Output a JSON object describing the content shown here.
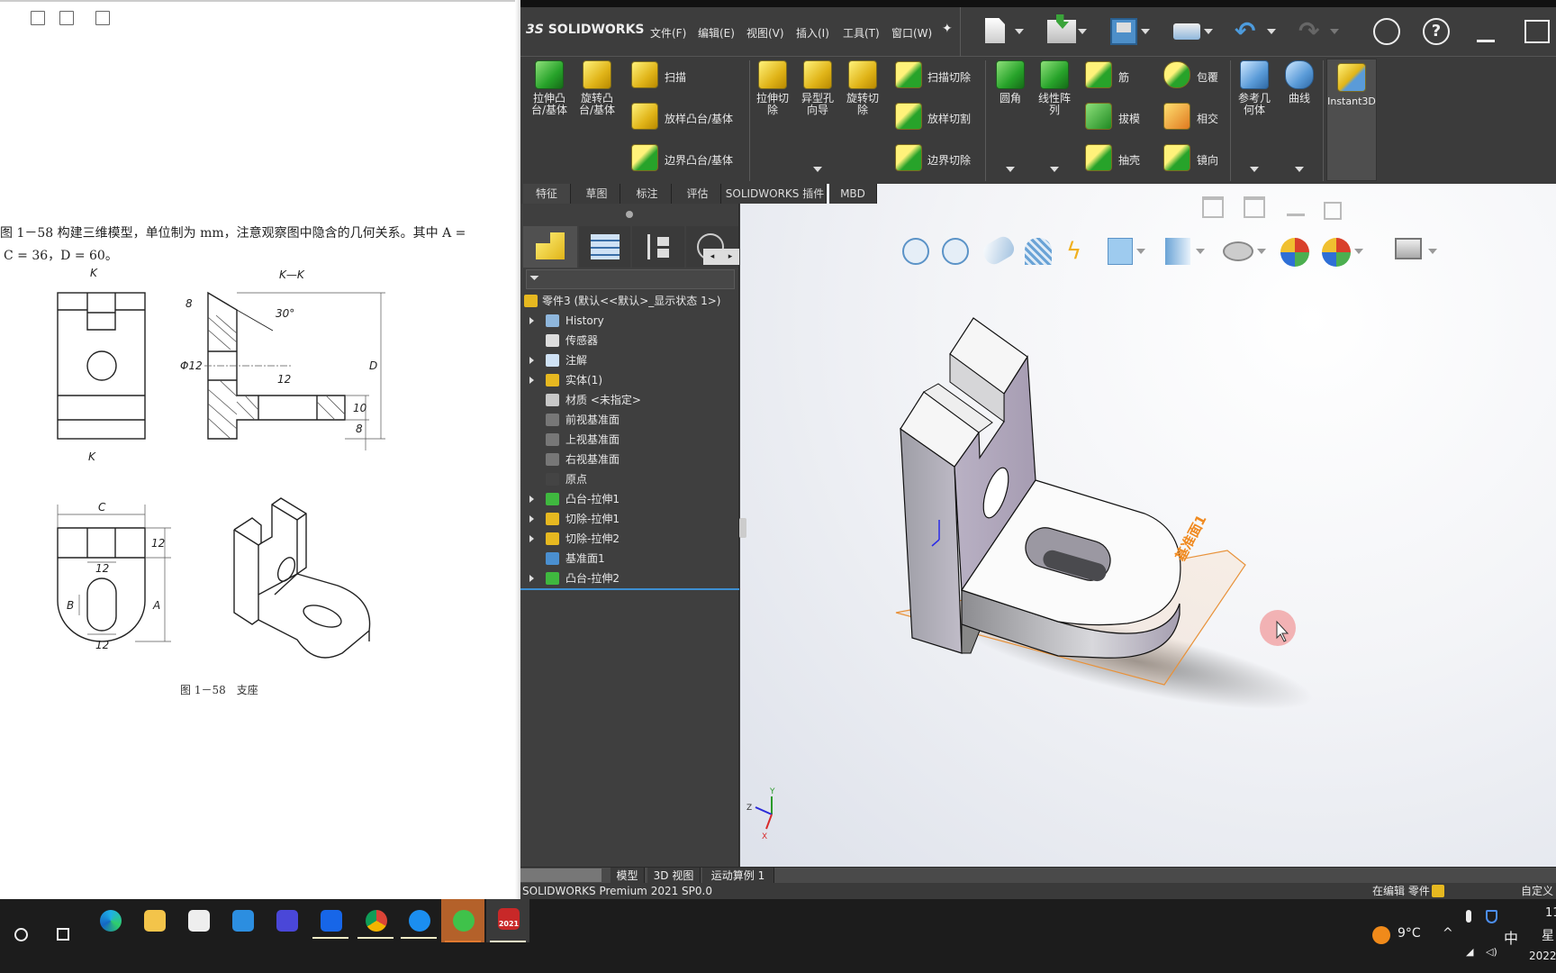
{
  "pdf": {
    "toolbar_icons": [
      "rotate-icon",
      "edit-icon",
      "download-icon"
    ],
    "text_line1": "图 1－58 构建三维模型，单位制为 mm，注意观察图中隐含的几何关系。其中 A =",
    "text_line2": "C = 36，D = 60。",
    "drawing": {
      "section_mark_top": "K",
      "section_mark_bottom": "K",
      "section_title": "K—K",
      "dim_8_top": "8",
      "dim_angle": "30°",
      "dim_phi": "Φ12",
      "dim_12_hole": "12",
      "dim_D": "D",
      "dim_10": "10",
      "dim_8_bottom": "8",
      "dim_C": "C",
      "dim_12_right": "12",
      "dim_12_slot_top": "12",
      "dim_B": "B",
      "dim_A": "A",
      "dim_12_slot_bottom": "12"
    },
    "caption": "图 1－58　支座"
  },
  "solidworks": {
    "logo": "SOLIDWORKS",
    "menus": [
      {
        "label": "文件(F)"
      },
      {
        "label": "编辑(E)"
      },
      {
        "label": "视图(V)"
      },
      {
        "label": "插入(I)"
      },
      {
        "label": "工具(T)"
      },
      {
        "label": "窗口(W)"
      }
    ],
    "quick_access": [
      "new-document-icon",
      "open-icon",
      "save-icon",
      "print-icon",
      "undo-icon",
      "redo-icon",
      "user-icon",
      "help-icon",
      "minimize-icon",
      "maximize-icon"
    ],
    "ribbon": {
      "extrude_boss": "拉伸凸\n台/基体",
      "revolve_boss": "旋转凸\n台/基体",
      "sweep": "扫描",
      "loft_boss": "放样凸台/基体",
      "boundary_boss": "边界凸台/基体",
      "extrude_cut": "拉伸切\n除",
      "hole_wizard": "异型孔\n向导",
      "revolve_cut": "旋转切\n除",
      "sweep_cut": "扫描切除",
      "loft_cut": "放样切割",
      "boundary_cut": "边界切除",
      "fillet": "圆角",
      "linear_pattern": "线性阵\n列",
      "rib": "筋",
      "draft": "拔模",
      "shell": "抽壳",
      "wrap": "包覆",
      "intersect": "相交",
      "mirror": "镜向",
      "reference_geometry": "参考几\n何体",
      "curves": "曲线",
      "instant3d": "Instant3D"
    },
    "command_tabs": [
      {
        "label": "特征"
      },
      {
        "label": "草图"
      },
      {
        "label": "标注"
      },
      {
        "label": "评估"
      },
      {
        "label": "SOLIDWORKS 插件"
      },
      {
        "label": "MBD"
      }
    ],
    "tree": {
      "root": "零件3  (默认<<默认>_显示状态 1>)",
      "items": [
        {
          "label": "History",
          "expandable": true
        },
        {
          "label": "传感器",
          "expandable": false
        },
        {
          "label": "注解",
          "expandable": true
        },
        {
          "label": "实体(1)",
          "expandable": true
        },
        {
          "label": "材质 <未指定>",
          "expandable": false
        },
        {
          "label": "前视基准面",
          "expandable": false
        },
        {
          "label": "上视基准面",
          "expandable": false
        },
        {
          "label": "右视基准面",
          "expandable": false
        },
        {
          "label": "原点",
          "expandable": false
        },
        {
          "label": "凸台-拉伸1",
          "expandable": true
        },
        {
          "label": "切除-拉伸1",
          "expandable": true
        },
        {
          "label": "切除-拉伸2",
          "expandable": true
        },
        {
          "label": "基准面1",
          "expandable": false
        },
        {
          "label": "凸台-拉伸2",
          "expandable": true
        }
      ]
    },
    "viewport": {
      "plane_label": "基准面1",
      "triad": {
        "x": "X",
        "y": "Y",
        "z": "Z"
      }
    },
    "bottom_tabs": [
      {
        "label": "模型"
      },
      {
        "label": "3D 视图"
      },
      {
        "label": "运动算例 1"
      }
    ],
    "status": {
      "product": "SOLIDWORKS Premium 2021 SP0.0",
      "mode": "在编辑 零件",
      "customize": "自定义"
    }
  },
  "taskbar": {
    "apps": [
      "edge",
      "file-explorer",
      "store",
      "mail",
      "video",
      "feishu",
      "chrome",
      "qq-browser",
      "wechat",
      "solidworks"
    ],
    "solidworks_badge": "2021",
    "weather": "9°C",
    "ime": "中",
    "time": "11",
    "day": "星",
    "date": "2022"
  },
  "colors": {
    "accent": "#e8a040",
    "sw_dark": "#3b3b3b",
    "active_task": "#b4612a"
  }
}
